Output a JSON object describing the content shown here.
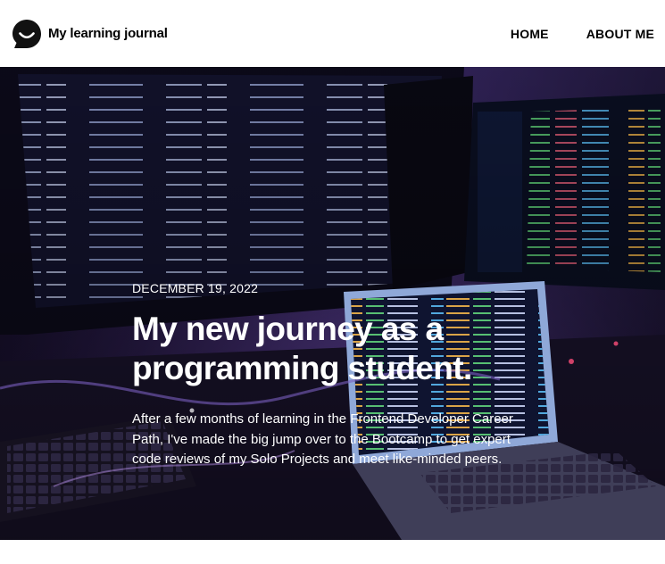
{
  "header": {
    "brand_title": "My learning journal",
    "logo_icon": "speech-bubble-smile-icon"
  },
  "nav": {
    "items": [
      {
        "label": "HOME"
      },
      {
        "label": "ABOUT ME"
      }
    ]
  },
  "hero": {
    "date": "DECEMBER 19, 2022",
    "title": "My new journey as a programming student.",
    "excerpt": "After a few months of learning in the Frontend Developer Career Path, I've made the big jump over to the Bootcamp to get expert code reviews of my Solo Projects and meet like-minded peers.",
    "image_subject": "desk-with-code-monitors-and-laptop-image"
  },
  "colors": {
    "header_bg": "#ffffff",
    "text_dark": "#000000",
    "hero_text": "#ffffff",
    "hero_tint": "#3b2a6a"
  }
}
